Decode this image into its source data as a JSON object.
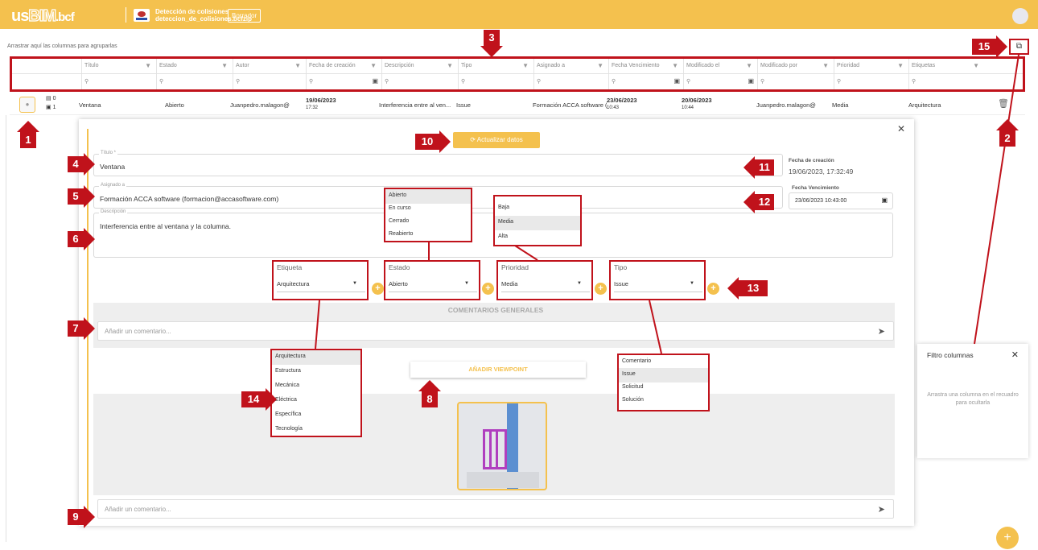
{
  "app": {
    "logo_us": "us",
    "logo_bim": "BIM",
    "logo_bcf": ".bcf",
    "project_title": "Detección de colisiones",
    "project_file": "deteccion_de_colisiones.bcfzip",
    "status_badge": "Borrador"
  },
  "grid": {
    "group_hint": "Arrastrar aquí las columnas para agruparlas",
    "columns": [
      {
        "label": "Título"
      },
      {
        "label": "Estado"
      },
      {
        "label": "Autor"
      },
      {
        "label": "Fecha de creación"
      },
      {
        "label": "Descripción"
      },
      {
        "label": "Tipo"
      },
      {
        "label": "Asignado a"
      },
      {
        "label": "Fecha Vencimiento"
      },
      {
        "label": "Modificado el"
      },
      {
        "label": "Modificado por"
      },
      {
        "label": "Prioridad"
      },
      {
        "label": "Etiquetas"
      }
    ],
    "row": {
      "comments": "0",
      "viewpoints": "1",
      "titulo": "Ventana",
      "estado": "Abierto",
      "autor": "Juanpedro.malagon@",
      "fecha_creacion": "19/06/2023",
      "hora_creacion": "17:32",
      "descripcion": "Interferencia entre al ven...",
      "tipo": "Issue",
      "asignado": "Formación ACCA software (",
      "fecha_venc": "23/06/2023",
      "hora_venc": "10:43",
      "modificado_el": "20/06/2023",
      "hora_mod": "10:44",
      "modificado_por": "Juanpedro.malagon@",
      "prioridad": "Media",
      "etiquetas": "Arquitectura"
    }
  },
  "detail": {
    "update_button": "Actualizar datos",
    "titulo_label": "Título *",
    "titulo_value": "Ventana",
    "asignado_label": "Asignado a",
    "asignado_value": "Formación ACCA software  (formacion@accasoftware.com)",
    "descripcion_label": "Descripción",
    "descripcion_value": "Interferencia entre al ventana y la columna.",
    "fecha_creacion_label": "Fecha de creación",
    "fecha_creacion_value": "19/06/2023, 17:32:49",
    "fecha_venc_label": "Fecha Vencimiento",
    "fecha_venc_value": "23/06/2023 10:43:00",
    "etiqueta_label": "Etiqueta",
    "etiqueta_value": "Arquitectura",
    "estado_label": "Estado",
    "estado_value": "Abierto",
    "prioridad_label": "Prioridad",
    "prioridad_value": "Media",
    "tipo_label": "Tipo",
    "tipo_value": "Issue",
    "comentarios_header": "COMENTARIOS GENERALES",
    "comment_placeholder": "Añadir un comentario...",
    "viewpoint_button": "AÑADIR VIEWPOINT"
  },
  "dropdowns": {
    "estado": [
      "Abierto",
      "En curso",
      "Cerrado",
      "Reabierto"
    ],
    "prioridad": [
      "Baja",
      "Media",
      "Alta"
    ],
    "etiqueta": [
      "Arquitectura",
      "Estructura",
      "Mecánica",
      "Eléctrica",
      "Específica",
      "Tecnología"
    ],
    "tipo": [
      "Comentario",
      "Issue",
      "Solicitud",
      "Solución"
    ]
  },
  "filter_panel": {
    "title": "Filtro columnas",
    "hint": "Arrastra una columna en el recuadro para ocultarla"
  },
  "callouts": [
    "1",
    "2",
    "3",
    "4",
    "5",
    "6",
    "7",
    "8",
    "9",
    "10",
    "11",
    "12",
    "13",
    "14",
    "15"
  ],
  "colors": {
    "accent": "#f4c14e",
    "callout": "#c0121b"
  }
}
